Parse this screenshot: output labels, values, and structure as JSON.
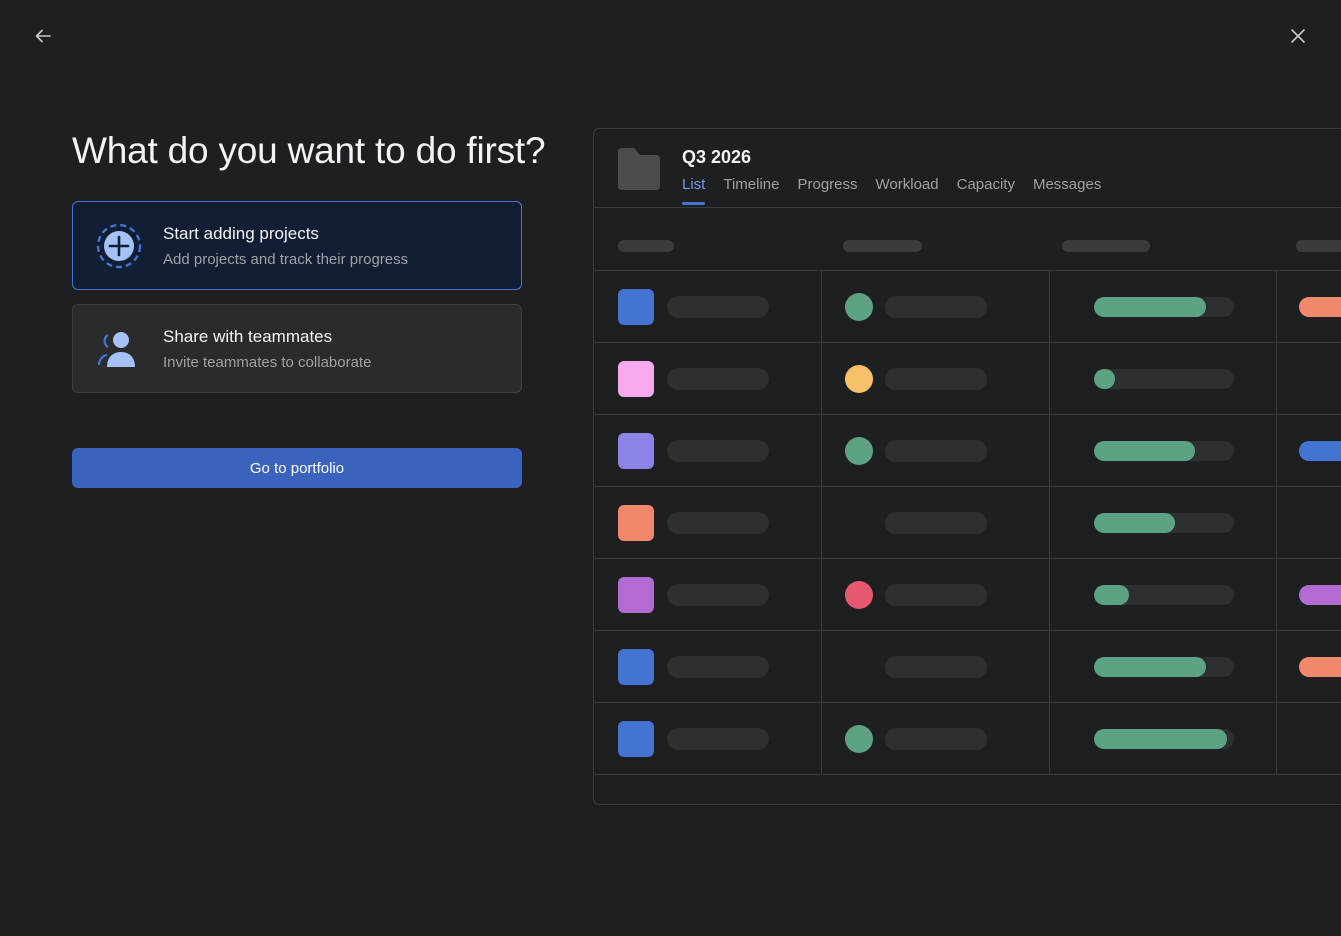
{
  "header": {
    "title": "What do you want to do first?"
  },
  "options": [
    {
      "title": "Start adding projects",
      "subtitle": "Add projects and track their progress",
      "selected": true,
      "icon": "plus-circle-icon"
    },
    {
      "title": "Share with teammates",
      "subtitle": "Invite teammates to collaborate",
      "selected": false,
      "icon": "teammates-icon"
    }
  ],
  "primary_button": {
    "label": "Go to portfolio"
  },
  "preview": {
    "project_name": "Q3 2026",
    "tabs": [
      "List",
      "Timeline",
      "Progress",
      "Workload",
      "Capacity",
      "Messages"
    ],
    "active_tab": "List",
    "rows": [
      {
        "color": "#4573d2",
        "status": "#5da283",
        "progress": 0.8,
        "tag": "#f1876b"
      },
      {
        "color": "#f9aaef",
        "status": "#f8c068",
        "progress": 0.15,
        "tag": null
      },
      {
        "color": "#8d84e8",
        "status": "#5da283",
        "progress": 0.72,
        "tag": "#4573d2"
      },
      {
        "color": "#f1876b",
        "status": null,
        "progress": 0.58,
        "tag": null
      },
      {
        "color": "#b36bd4",
        "status": "#e5586d",
        "progress": 0.25,
        "tag": "#b36bd4"
      },
      {
        "color": "#4573d2",
        "status": null,
        "progress": 0.8,
        "tag": "#f1876b"
      },
      {
        "color": "#4573d2",
        "status": "#5da283",
        "progress": 0.95,
        "tag": null
      }
    ]
  },
  "colors": {
    "background": "#1e1f21",
    "accent": "#4573d2",
    "button": "#3a63bd",
    "progress": "#5da283"
  }
}
